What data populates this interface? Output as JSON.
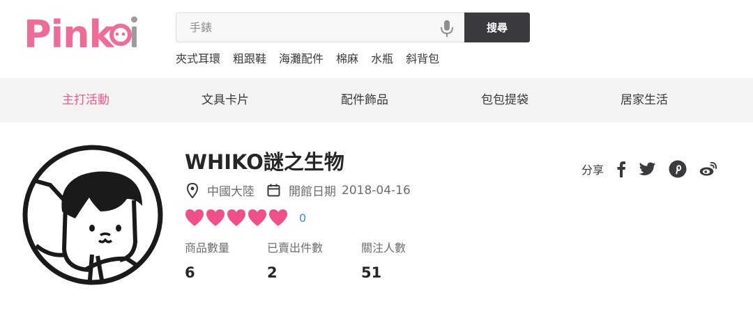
{
  "brand": {
    "name": "Pinkoi",
    "accent_color": "#ed5990"
  },
  "search": {
    "placeholder": "手錶",
    "button_label": "搜尋"
  },
  "hot_keywords": [
    "夾式耳環",
    "粗跟鞋",
    "海灘配件",
    "棉麻",
    "水瓶",
    "斜背包"
  ],
  "categories": [
    {
      "label": "主打活動",
      "active": true
    },
    {
      "label": "文具卡片",
      "active": false
    },
    {
      "label": "配件飾品",
      "active": false
    },
    {
      "label": "包包提袋",
      "active": false
    },
    {
      "label": "居家生活",
      "active": false
    }
  ],
  "shop": {
    "name": "WHIKO謎之生物",
    "location": "中國大陸",
    "opened_label": "開館日期",
    "opened_date": "2018-04-16",
    "rating_hearts": 5,
    "review_count": "0",
    "stats": [
      {
        "label": "商品數量",
        "value": "6"
      },
      {
        "label": "已賣出件數",
        "value": "2"
      },
      {
        "label": "關注人數",
        "value": "51"
      }
    ]
  },
  "share": {
    "label": "分享",
    "icons": [
      "facebook-icon",
      "twitter-icon",
      "pinterest-icon",
      "weibo-icon"
    ]
  }
}
